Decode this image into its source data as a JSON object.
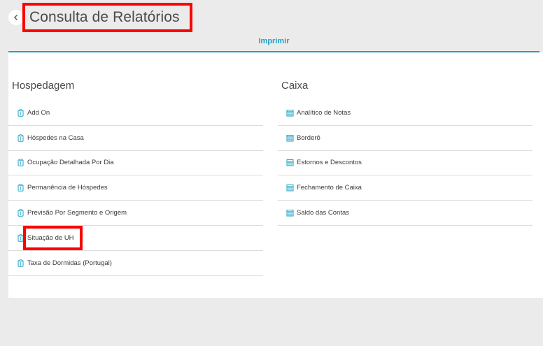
{
  "header": {
    "title": "Consulta de Relatórios",
    "back_icon": "chevron-left-icon"
  },
  "tabs": [
    {
      "label": "Imprimir",
      "active": true
    }
  ],
  "colors": {
    "accent": "#1ba3c4",
    "highlight": "#ff0000",
    "background": "#ebebeb"
  },
  "sections": {
    "hospedagem": {
      "title": "Hospedagem",
      "icon": "clipboard-icon",
      "items": [
        "Add On",
        "Hóspedes na Casa",
        "Ocupação Detalhada Por Dia",
        "Permanência de Hóspedes",
        "Previsão Por Segmento e Origem",
        "Situação de UH",
        "Taxa de Dormidas (Portugal)"
      ]
    },
    "caixa": {
      "title": "Caixa",
      "icon": "calendar-grid-icon",
      "items": [
        "Analítico de Notas",
        "Borderô",
        "Estornos e Descontos",
        "Fechamento de Caixa",
        "Saldo das Contas"
      ]
    }
  }
}
